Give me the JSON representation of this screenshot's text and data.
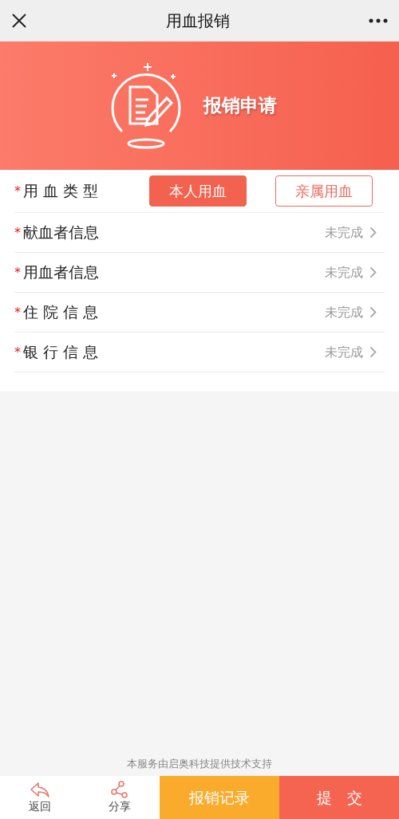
{
  "window": {
    "title": "用血报销"
  },
  "banner": {
    "title": "报销申请"
  },
  "blood_type": {
    "label": "用 血 类 型",
    "required_mark": "*",
    "options": [
      {
        "label": "本人用血",
        "selected": true
      },
      {
        "label": "亲属用血",
        "selected": false
      }
    ]
  },
  "sections": [
    {
      "label": "献血者信息",
      "required_mark": "*",
      "status": "未完成"
    },
    {
      "label": "用血者信息",
      "required_mark": "*",
      "status": "未完成"
    },
    {
      "label": "住 院 信 息",
      "required_mark": "*",
      "status": "未完成"
    },
    {
      "label": "银 行 信 息",
      "required_mark": "*",
      "status": "未完成"
    }
  ],
  "footer_note": "本服务由启奥科技提供技术支持",
  "bottom_bar": [
    {
      "kind": "back",
      "label": "返回"
    },
    {
      "kind": "share",
      "label": "分享"
    },
    {
      "kind": "secondary",
      "label": "报销记录"
    },
    {
      "kind": "primary",
      "label": "提　交"
    }
  ]
}
